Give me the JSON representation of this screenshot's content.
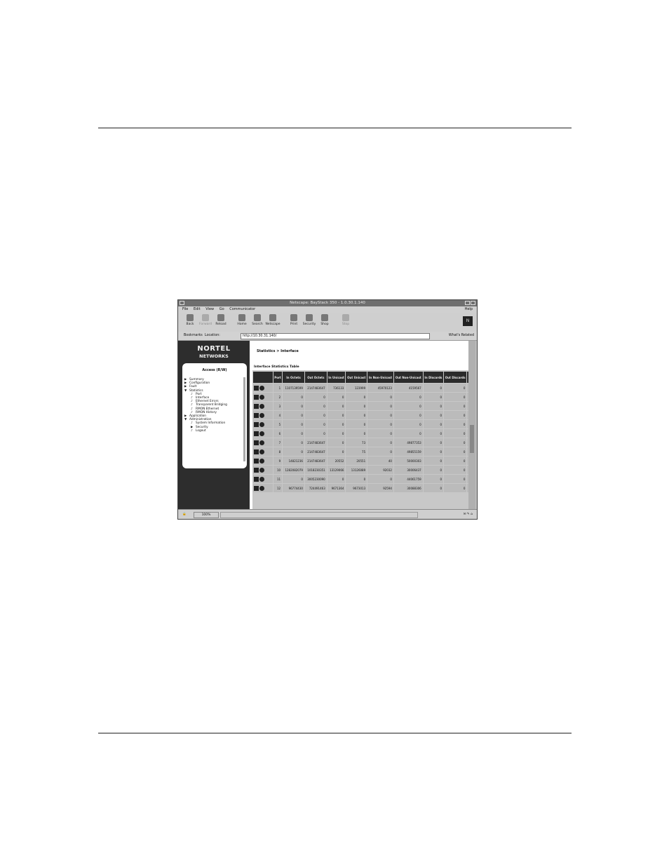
{
  "window": {
    "title": "Netscape: BayStack 350 - 1.0.30.1.140",
    "menus": [
      "File",
      "Edit",
      "View",
      "Go",
      "Communicator"
    ],
    "help": "Help"
  },
  "toolbar": {
    "buttons": [
      {
        "label": "Back",
        "enabled": true
      },
      {
        "label": "Forward",
        "enabled": false
      },
      {
        "label": "Reload",
        "enabled": true
      },
      {
        "label": "Home",
        "enabled": true
      },
      {
        "label": "Search",
        "enabled": true
      },
      {
        "label": "Netscape",
        "enabled": true
      },
      {
        "label": "Print",
        "enabled": true
      },
      {
        "label": "Security",
        "enabled": true
      },
      {
        "label": "Shop",
        "enabled": true
      },
      {
        "label": "Stop",
        "enabled": false
      }
    ],
    "brand": "N"
  },
  "location": {
    "bookmarks": "Bookmarks",
    "label": "Location:",
    "url": "http://10.30.31.140/",
    "related": "What's Related"
  },
  "sidebar": {
    "logo_line1": "NORTEL",
    "logo_line2": "NETWORKS",
    "panel_title": "Access (R/W)",
    "items": [
      {
        "label": "Summary",
        "level": 1,
        "marker": "▶"
      },
      {
        "label": "Configuration",
        "level": 1,
        "marker": "▶"
      },
      {
        "label": "Fault",
        "level": 1,
        "marker": "▶"
      },
      {
        "label": "Statistics",
        "level": 1,
        "marker": "▼"
      },
      {
        "label": "Port",
        "level": 2,
        "marker": "♪"
      },
      {
        "label": "Interface",
        "level": 2,
        "marker": "♪"
      },
      {
        "label": "Ethernet Errors",
        "level": 2,
        "marker": "♪"
      },
      {
        "label": "Transparent Bridging",
        "level": 2,
        "marker": "♪"
      },
      {
        "label": "RMON Ethernet",
        "level": 2,
        "marker": "♪"
      },
      {
        "label": "RMON History",
        "level": 2,
        "marker": "♪"
      },
      {
        "label": "Application",
        "level": 1,
        "marker": "▶"
      },
      {
        "label": "Administration",
        "level": 1,
        "marker": "▼"
      },
      {
        "label": "System Information",
        "level": 2,
        "marker": "♪"
      },
      {
        "label": "Security",
        "level": 2,
        "marker": "▶"
      },
      {
        "label": "Logout",
        "level": 2,
        "marker": "♪"
      }
    ]
  },
  "content": {
    "breadcrumb": "Statistics > Interface",
    "table_title": "Interface Statistics Table",
    "columns": [
      "Port",
      "In Octets",
      "Out Octets",
      "In Unicast",
      "Out Unicast",
      "In Non-Unicast",
      "Out Non-Unicast",
      "In Discards",
      "Out Discards",
      "In Errors"
    ],
    "rows": [
      [
        "1",
        "1107139599",
        "2147483647",
        "736133",
        "123999",
        "45970123",
        "4159567",
        "0",
        "0",
        ""
      ],
      [
        "2",
        "0",
        "0",
        "0",
        "0",
        "0",
        "0",
        "0",
        "0",
        ""
      ],
      [
        "3",
        "0",
        "0",
        "0",
        "0",
        "0",
        "0",
        "0",
        "0",
        ""
      ],
      [
        "4",
        "0",
        "0",
        "0",
        "0",
        "0",
        "0",
        "0",
        "0",
        ""
      ],
      [
        "5",
        "0",
        "0",
        "0",
        "0",
        "0",
        "0",
        "0",
        "0",
        ""
      ],
      [
        "6",
        "0",
        "0",
        "0",
        "0",
        "0",
        "0",
        "0",
        "0",
        ""
      ],
      [
        "7",
        "0",
        "2147483647",
        "0",
        "73",
        "0",
        "49877353",
        "0",
        "0",
        ""
      ],
      [
        "8",
        "0",
        "2147483647",
        "0",
        "75",
        "0",
        "49855159",
        "0",
        "0",
        ""
      ],
      [
        "9",
        "14821236",
        "2147483647",
        "20552",
        "20551",
        "40",
        "50000303",
        "0",
        "0",
        ""
      ],
      [
        "10",
        "1282082079",
        "1018230351",
        "13129066",
        "13126089",
        "92032",
        "30006437",
        "0",
        "0",
        ""
      ],
      [
        "11",
        "0",
        "3005230090",
        "0",
        "0",
        "0",
        "44061759",
        "0",
        "0",
        ""
      ],
      [
        "12",
        "96774430",
        "724491463",
        "9671364",
        "9673013",
        "92594",
        "30088306",
        "0",
        "0",
        ""
      ]
    ]
  },
  "status": {
    "percent": "100%"
  }
}
